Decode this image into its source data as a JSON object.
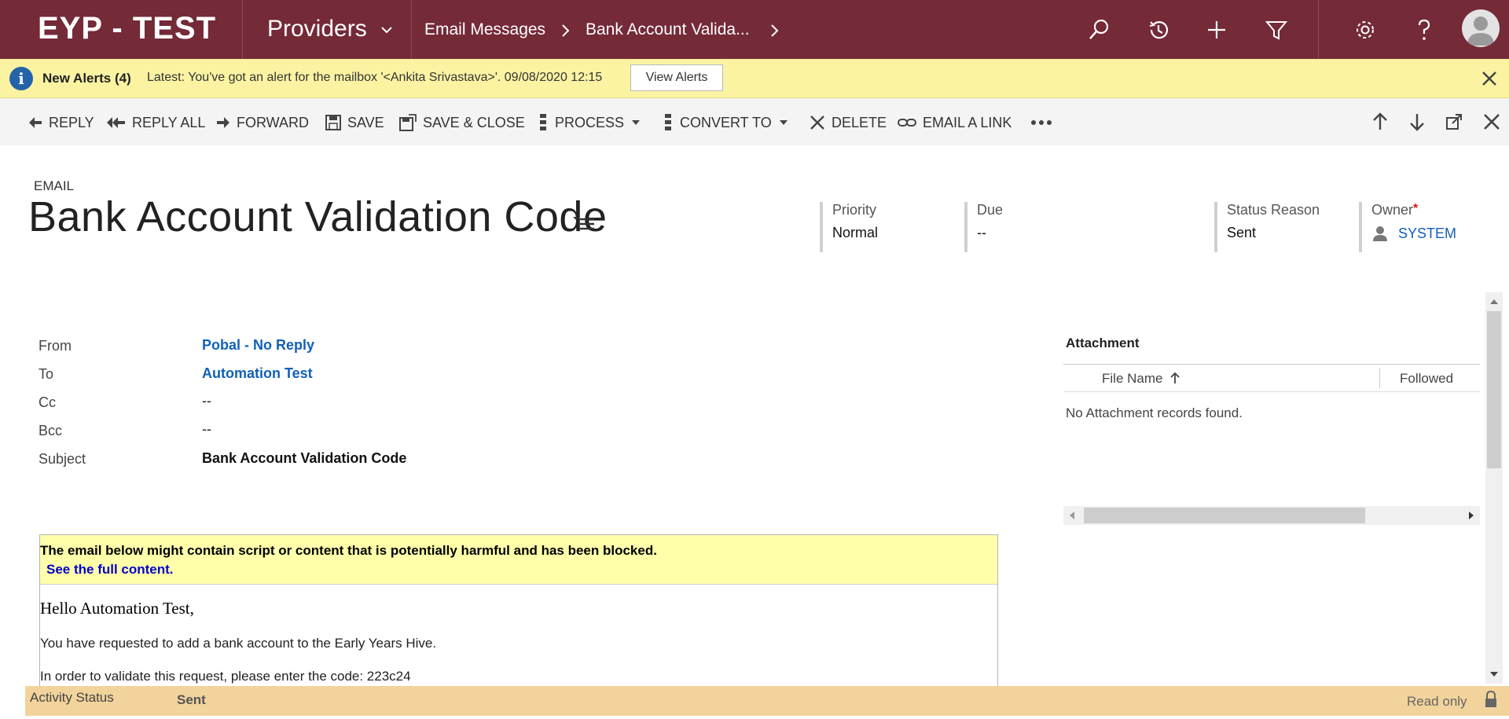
{
  "topbar": {
    "app_title": "EYP - TEST",
    "module": "Providers",
    "breadcrumb": [
      "Email Messages",
      "Bank Account Valida..."
    ]
  },
  "alert": {
    "title": "New Alerts (4)",
    "text": "Latest: You've got an alert for the mailbox '<Ankita Srivastava>'. 09/08/2020 12:15",
    "button": "View Alerts"
  },
  "commands": {
    "reply": "REPLY",
    "reply_all": "REPLY ALL",
    "forward": "FORWARD",
    "save": "SAVE",
    "save_close": "SAVE & CLOSE",
    "process": "PROCESS",
    "convert_to": "CONVERT TO",
    "delete": "DELETE",
    "email_link": "EMAIL A LINK"
  },
  "header": {
    "entity": "EMAIL",
    "title": "Bank Account Validation Code",
    "priority_label": "Priority",
    "priority_value": "Normal",
    "due_label": "Due",
    "due_value": "--",
    "status_label": "Status Reason",
    "status_value": "Sent",
    "owner_label": "Owner",
    "owner_required": "*",
    "owner_value": "SYSTEM"
  },
  "fields": {
    "from_label": "From",
    "from_value": "Pobal - No Reply",
    "to_label": "To",
    "to_value": "Automation Test",
    "cc_label": "Cc",
    "cc_value": "--",
    "bcc_label": "Bcc",
    "bcc_value": "--",
    "subject_label": "Subject",
    "subject_value": "Bank Account Validation Code"
  },
  "email": {
    "warning": "The email below might contain script or content that is potentially harmful and has been blocked.",
    "see_full": "See the full content.",
    "greeting": "Hello Automation Test,",
    "line1": "You have requested to add a bank account to the Early Years Hive.",
    "line2": "In order to validate this request, please enter the code: 223c24"
  },
  "attachment": {
    "title": "Attachment",
    "col_file": "File Name",
    "col_followed": "Followed",
    "empty": "No Attachment records found."
  },
  "footer": {
    "label": "Activity Status",
    "value": "Sent",
    "readonly": "Read only"
  }
}
